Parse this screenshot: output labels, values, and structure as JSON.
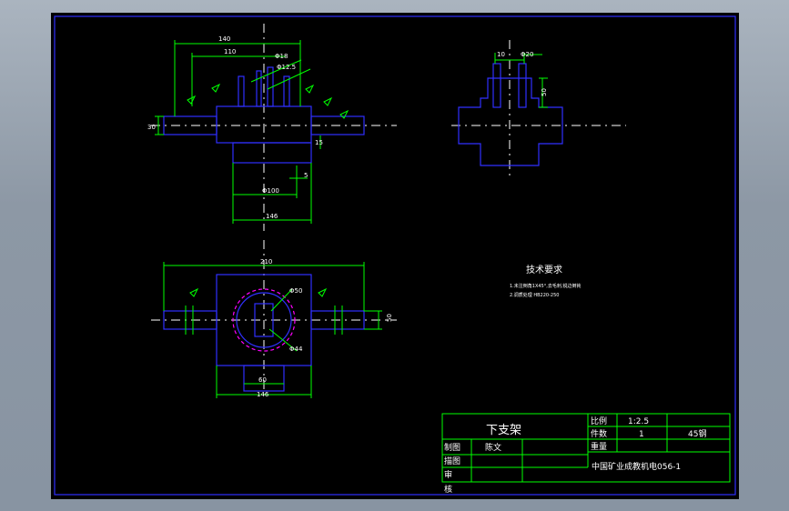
{
  "dimensions": {
    "d140": "140",
    "d110": "110",
    "d10": "10",
    "dphi18": "Φ18",
    "dphi12": "Φ12.5",
    "d5": "5",
    "dphi100": "Φ100",
    "d146": "146",
    "d30": "30",
    "d15": "15",
    "dsec10": "10",
    "dsec20": "Φ20",
    "dsec50": "50",
    "dplan210": "210",
    "dR50": "Φ50",
    "dR44": "Φ44",
    "d60": "60",
    "d146b": "146",
    "d50": "50"
  },
  "notes": {
    "heading": "技术要求",
    "line1": "1.未注倒角1X45°,去毛刺,锐边倒钝",
    "line2": "2.调质处理 HB220-250"
  },
  "title_block": {
    "part_name": "下支架",
    "scale_label": "比例",
    "scale_value": "1:2.5",
    "qty_label": "件数",
    "qty_value": "1",
    "material": "45钢",
    "weight_label": "重量",
    "drawn_label": "制图",
    "drawn_name": "陈文",
    "traced_label": "描图",
    "review_label": "审",
    "check_label": "核",
    "organization": "中国矿业成教机电056-1"
  }
}
